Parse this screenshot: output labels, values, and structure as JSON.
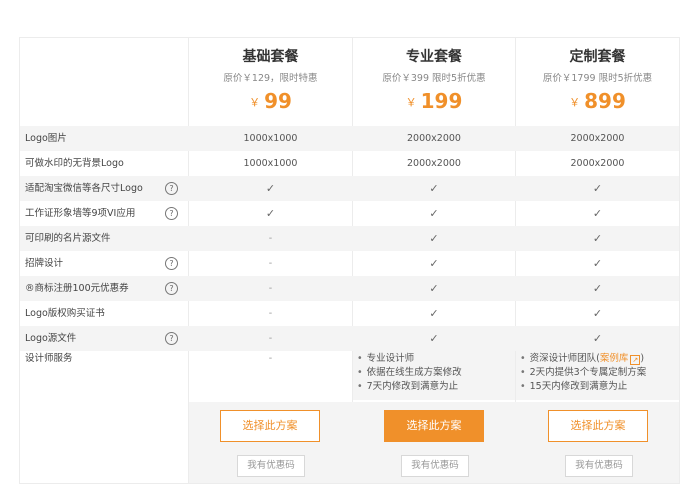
{
  "plans": [
    {
      "name": "基础套餐",
      "original": "原价￥129，限时特惠",
      "currency": "￥",
      "price": "99",
      "choose_label": "选择此方案",
      "coupon_label": "我有优惠码"
    },
    {
      "name": "专业套餐",
      "original": "原价￥399 限时5折优惠",
      "currency": "￥",
      "price": "199",
      "choose_label": "选择此方案",
      "coupon_label": "我有优惠码"
    },
    {
      "name": "定制套餐",
      "original": "原价￥1799 限时5折优惠",
      "currency": "￥",
      "price": "899",
      "choose_label": "选择此方案",
      "coupon_label": "我有优惠码"
    }
  ],
  "features": [
    {
      "label": "Logo图片",
      "help": false,
      "values": [
        "1000x1000",
        "2000x2000",
        "2000x2000"
      ]
    },
    {
      "label": "可做水印的无背景Logo",
      "help": false,
      "values": [
        "1000x1000",
        "2000x2000",
        "2000x2000"
      ]
    },
    {
      "label": "适配淘宝微信等各尺寸Logo",
      "help": true,
      "values": [
        "✓",
        "✓",
        "✓"
      ]
    },
    {
      "label": "工作证形象墙等9项VI应用",
      "help": true,
      "values": [
        "✓",
        "✓",
        "✓"
      ]
    },
    {
      "label": "可印刷的名片源文件",
      "help": false,
      "values": [
        "-",
        "✓",
        "✓"
      ]
    },
    {
      "label": "招牌设计",
      "help": true,
      "values": [
        "-",
        "✓",
        "✓"
      ]
    },
    {
      "label": "®商标注册100元优惠券",
      "help": true,
      "values": [
        "-",
        "✓",
        "✓"
      ]
    },
    {
      "label": "Logo版权购买证书",
      "help": false,
      "values": [
        "-",
        "✓",
        "✓"
      ]
    },
    {
      "label": "Logo源文件",
      "help": true,
      "values": [
        "-",
        "✓",
        "✓"
      ]
    }
  ],
  "help_glyph": "?",
  "designer_service": {
    "label": "设计师服务",
    "basic": "-",
    "pro": [
      "专业设计师",
      "依据在线生成方案修改",
      "7天内修改到满意为止"
    ],
    "custom_first_prefix": "资深设计师团队(",
    "custom_first_link": "案例库",
    "custom_first_suffix": ")",
    "custom_rest": [
      "2天内提供3个专属定制方案",
      "15天内修改到满意为止"
    ]
  },
  "bullet": "•",
  "icons": {
    "check": "check-icon",
    "help": "question-circle-icon",
    "external": "external-link-icon"
  },
  "colors": {
    "accent": "#f0902a",
    "shade": "#f4f4f4",
    "border": "#ececec"
  }
}
